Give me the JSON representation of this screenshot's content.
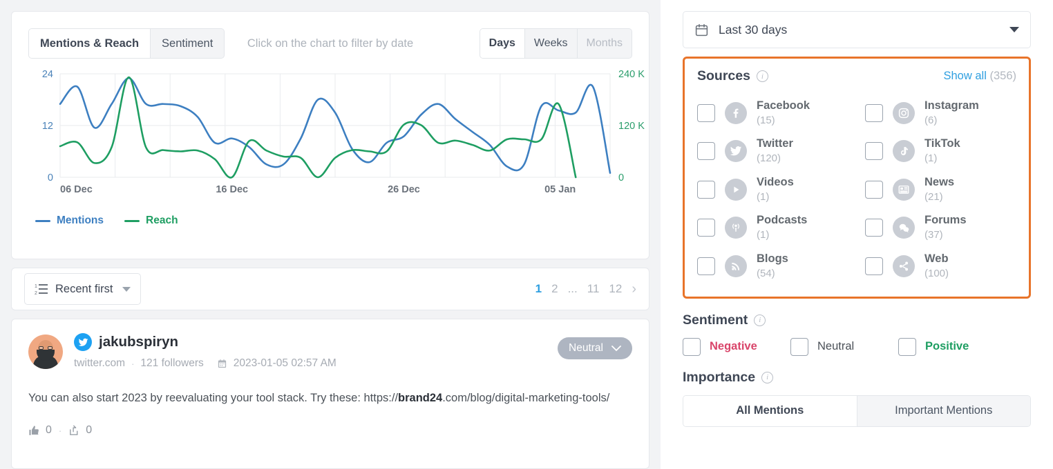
{
  "chart_panel": {
    "view_tabs": [
      {
        "label": "Mentions & Reach",
        "active": true
      },
      {
        "label": "Sentiment",
        "active": false
      }
    ],
    "hint": "Click on the chart to filter by date",
    "granularity_tabs": [
      {
        "label": "Days",
        "active": true,
        "muted": false
      },
      {
        "label": "Weeks",
        "active": false,
        "muted": false
      },
      {
        "label": "Months",
        "active": false,
        "muted": true
      }
    ],
    "legend": [
      {
        "label": "Mentions",
        "color": "#3d7fc1"
      },
      {
        "label": "Reach",
        "color": "#1e9e62"
      }
    ]
  },
  "chart_data": {
    "type": "line",
    "title": "",
    "xlabel": "",
    "ylabel": "Mentions",
    "y2label": "Reach",
    "grid": true,
    "legend_position": "bottom-left",
    "x_tick_labels": [
      "06 Dec",
      "16 Dec",
      "26 Dec",
      "05 Jan"
    ],
    "y_left_ticks": [
      0,
      12,
      24
    ],
    "y_left_lim": [
      0,
      24
    ],
    "y_left_color": "#4a82b8",
    "y_right_ticks": [
      "0",
      "120 K",
      "240 K"
    ],
    "y_right_lim": [
      0,
      240000
    ],
    "y_right_color": "#2a9d6b",
    "x": [
      "06 Dec",
      "07 Dec",
      "08 Dec",
      "09 Dec",
      "10 Dec",
      "11 Dec",
      "12 Dec",
      "13 Dec",
      "14 Dec",
      "15 Dec",
      "16 Dec",
      "17 Dec",
      "18 Dec",
      "19 Dec",
      "20 Dec",
      "21 Dec",
      "22 Dec",
      "23 Dec",
      "24 Dec",
      "25 Dec",
      "26 Dec",
      "27 Dec",
      "28 Dec",
      "29 Dec",
      "30 Dec",
      "31 Dec",
      "01 Jan",
      "02 Jan",
      "03 Jan",
      "04 Jan",
      "05 Jan"
    ],
    "series": [
      {
        "name": "Mentions",
        "color": "#3d7fc1",
        "axis": "left",
        "values": [
          17,
          21,
          11.5,
          17,
          23,
          17,
          17,
          16.5,
          14,
          8,
          9,
          7,
          3,
          3,
          9,
          18,
          15,
          6.5,
          3.5,
          8,
          9.5,
          14.5,
          17,
          13.5,
          10.5,
          7.5,
          2.5,
          3,
          16.5,
          15.5,
          15,
          21,
          1
        ]
      },
      {
        "name": "Reach",
        "color": "#1e9e62",
        "axis": "right",
        "values": [
          72000,
          81000,
          33000,
          70000,
          232000,
          69000,
          63000,
          60000,
          62000,
          42000,
          0,
          84000,
          62000,
          48000,
          45000,
          0,
          45000,
          63000,
          60000,
          60000,
          122000,
          121000,
          80000,
          85000,
          75000,
          62000,
          88000,
          88000,
          88000,
          170000,
          0
        ]
      }
    ]
  },
  "sortbar": {
    "sort_label": "Recent first",
    "pages": [
      {
        "label": "1",
        "active": true
      },
      {
        "label": "2",
        "active": false
      },
      {
        "label": "...",
        "active": false
      },
      {
        "label": "11",
        "active": false
      },
      {
        "label": "12",
        "active": false
      }
    ],
    "next_glyph": "›"
  },
  "mention": {
    "author": "jakubspiryn",
    "domain": "twitter.com",
    "followers": "121 followers",
    "separator": "·",
    "date": "2023-01-05 02:57 AM",
    "sentiment": "Neutral",
    "text_before": "You can also start 2023 by reevaluating your tool stack. Try these: https://",
    "text_bold": "brand24",
    "text_after": ".com/blog/digital-marketing-tools/",
    "likes": "0",
    "shares": "0",
    "action_sep": "·"
  },
  "filters": {
    "date_range": "Last 30 days",
    "sources": {
      "title": "Sources",
      "show_all": "Show all",
      "show_all_count": "(356)",
      "items": [
        {
          "name": "Facebook",
          "count": "(15)",
          "icon": "facebook-icon",
          "checked": false
        },
        {
          "name": "Instagram",
          "count": "(6)",
          "icon": "instagram-icon",
          "checked": false
        },
        {
          "name": "Twitter",
          "count": "(120)",
          "icon": "twitter-icon",
          "checked": false
        },
        {
          "name": "TikTok",
          "count": "(1)",
          "icon": "tiktok-icon",
          "checked": false
        },
        {
          "name": "Videos",
          "count": "(1)",
          "icon": "video-play-icon",
          "checked": false
        },
        {
          "name": "News",
          "count": "(21)",
          "icon": "newspaper-icon",
          "checked": false
        },
        {
          "name": "Podcasts",
          "count": "(1)",
          "icon": "podcast-icon",
          "checked": false
        },
        {
          "name": "Forums",
          "count": "(37)",
          "icon": "forum-bubbles-icon",
          "checked": false
        },
        {
          "name": "Blogs",
          "count": "(54)",
          "icon": "rss-icon",
          "checked": false
        },
        {
          "name": "Web",
          "count": "(100)",
          "icon": "share-nodes-icon",
          "checked": false
        }
      ]
    },
    "sentiment": {
      "title": "Sentiment",
      "items": [
        {
          "label": "Negative",
          "color": "#d9456a",
          "checked": false
        },
        {
          "label": "Neutral",
          "color": "#4b5158",
          "checked": false
        },
        {
          "label": "Positive",
          "color": "#1e9e62",
          "checked": false
        }
      ]
    },
    "importance": {
      "title": "Importance",
      "options": [
        {
          "label": "All Mentions",
          "active": true
        },
        {
          "label": "Important Mentions",
          "active": false
        }
      ]
    }
  },
  "colors": {
    "accent_blue": "#2f9fe0",
    "highlight_orange": "#e8742a",
    "mentions_line": "#3d7fc1",
    "reach_line": "#1e9e62"
  }
}
